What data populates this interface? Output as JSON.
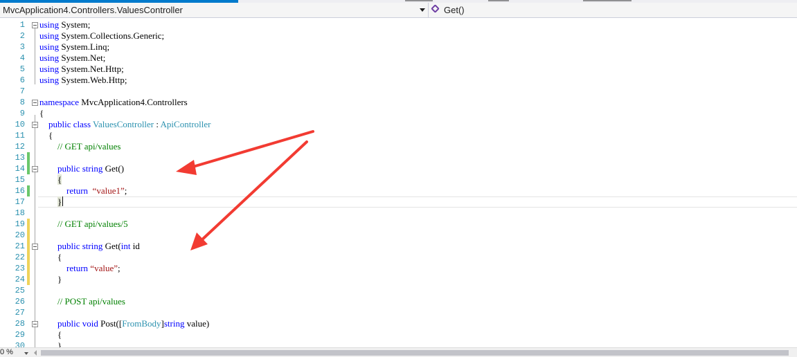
{
  "navbar": {
    "type_dropdown": "MvcApplication4.Controllers.ValuesController",
    "member_dropdown": "Get()"
  },
  "zoom": {
    "level": "0 %"
  },
  "lines": [
    {
      "n": "1"
    },
    {
      "n": "2"
    },
    {
      "n": "3"
    },
    {
      "n": "4"
    },
    {
      "n": "5"
    },
    {
      "n": "6"
    },
    {
      "n": "7"
    },
    {
      "n": "8"
    },
    {
      "n": "9"
    },
    {
      "n": "10"
    },
    {
      "n": "11"
    },
    {
      "n": "12"
    },
    {
      "n": "13"
    },
    {
      "n": "14"
    },
    {
      "n": "15"
    },
    {
      "n": "16"
    },
    {
      "n": "17"
    },
    {
      "n": "18"
    },
    {
      "n": "19"
    },
    {
      "n": "20"
    },
    {
      "n": "21"
    },
    {
      "n": "22"
    },
    {
      "n": "23"
    },
    {
      "n": "24"
    },
    {
      "n": "25"
    },
    {
      "n": "26"
    },
    {
      "n": "27"
    },
    {
      "n": "28"
    },
    {
      "n": "29"
    },
    {
      "n": "30"
    }
  ],
  "code": {
    "using": "using",
    "system": " System;",
    "collections": " System.Collections.Generic;",
    "linq": " System.Linq;",
    "net": " System.Net;",
    "nethttp": " System.Net.Http;",
    "webhttp": " System.Web.Http;",
    "namespace_kw": "namespace",
    "namespace_name": " MvcApplication4.Controllers",
    "open_brace": "{",
    "close_brace": "}",
    "public": "public",
    "class": "class",
    "class_name": "ValuesController",
    "colon": " : ",
    "base_class": "ApiController",
    "comment_get": "// GET api/values",
    "string": "string",
    "get_sig": " Get()",
    "return": "return",
    "value1": "“value1”",
    "semicolon": ";",
    "comment_get_id": "// GET api/values/5",
    "get_id_sig": " Get(",
    "int": "int",
    "id_frag": " id",
    "value": "“value”",
    "comment_post": "// POST api/values",
    "void": "void",
    "post_sig": " Post([",
    "frombody": "FromBody",
    "post_rest": "]",
    "post_param": " value)"
  },
  "colors": {
    "keyword": "#0000ff",
    "comment": "#008000",
    "type": "#2b91af",
    "string": "#a31515",
    "change_saved": "#6bc76b",
    "change_unsaved": "#efd35a",
    "annotation_arrow": "#f23b32"
  }
}
